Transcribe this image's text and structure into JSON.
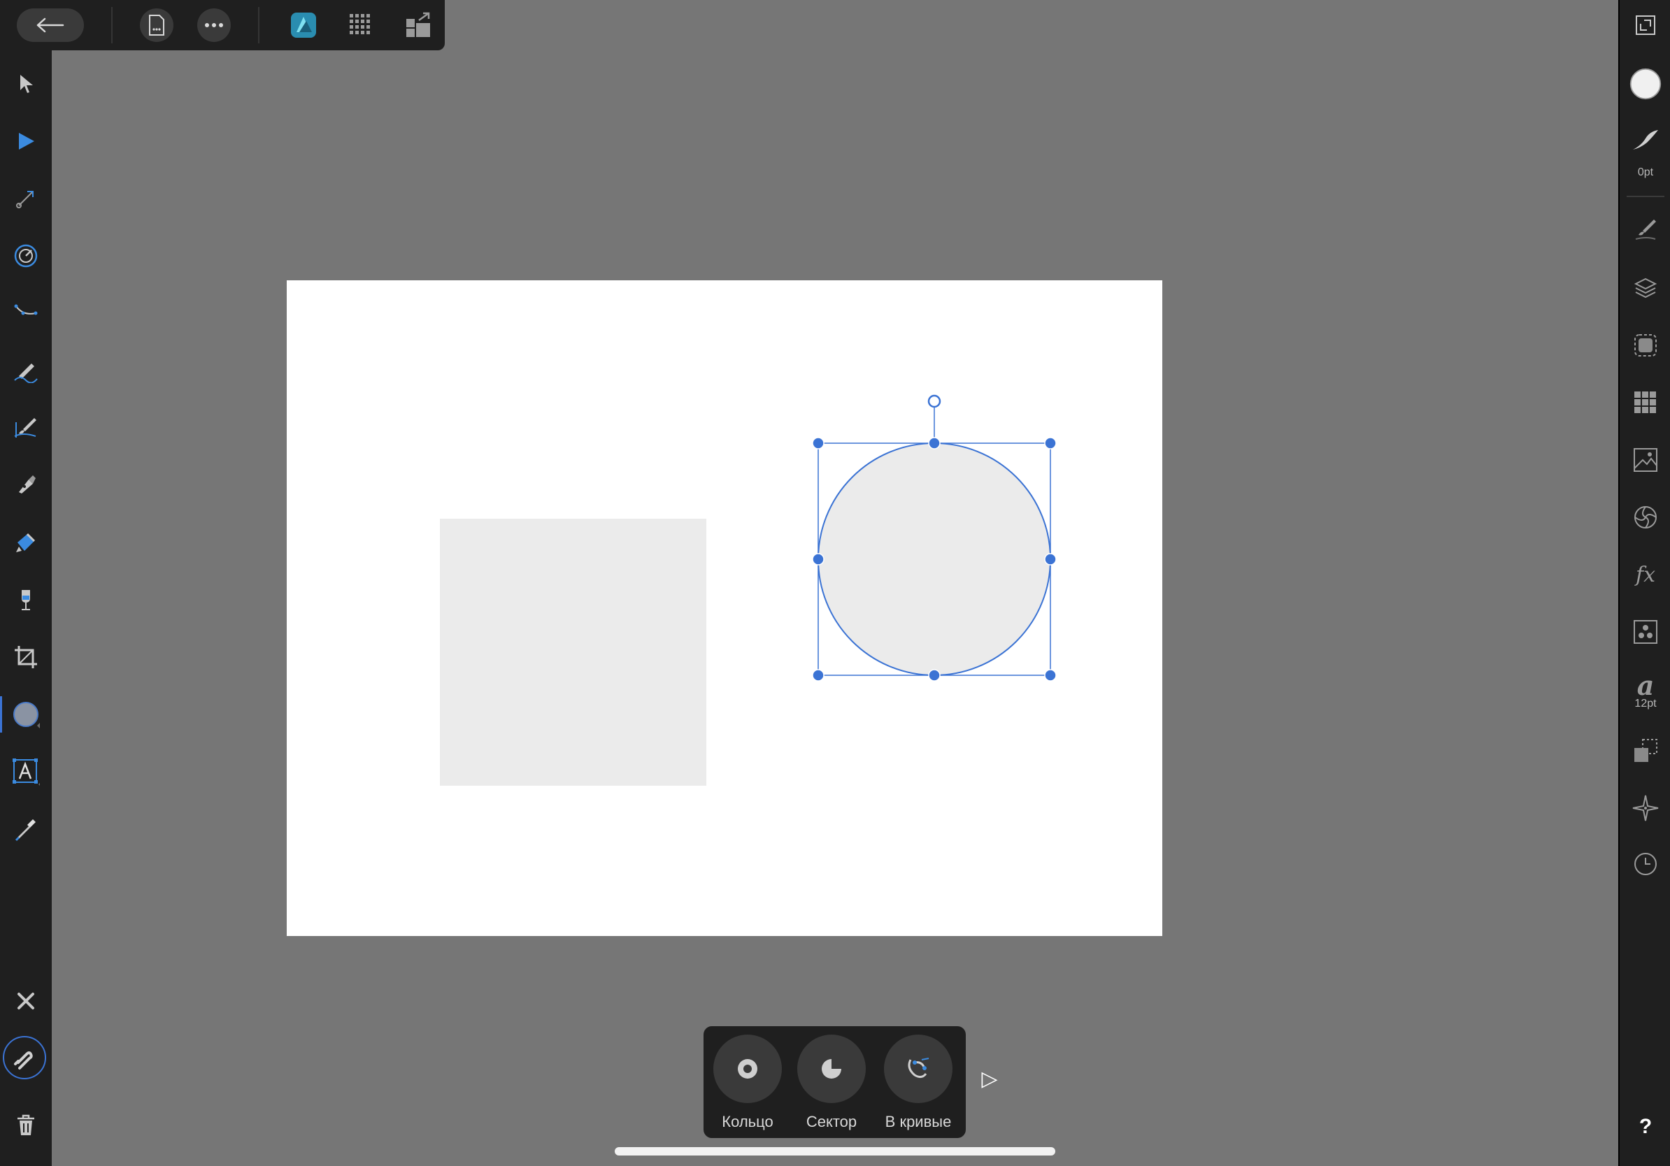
{
  "app": {
    "name": "Affinity Designer"
  },
  "top_toolbar": {
    "items": [
      "back-arrow-icon",
      "document-menu-icon",
      "more-icon",
      "designer-persona-icon",
      "pixel-persona-icon",
      "export-persona-icon"
    ]
  },
  "left_toolbar": {
    "tools": [
      "move-tool",
      "node-tool",
      "point-transform-tool",
      "corner-tool",
      "pen-tool",
      "pencil-tool",
      "vector-brush-tool",
      "fill-tool",
      "transparency-tool",
      "vector-crop-tool",
      "ellipse-tool",
      "artistic-text-tool",
      "color-picker-tool"
    ],
    "selected_tool": "ellipse-tool",
    "bottom": [
      "close-icon",
      "snapping-icon",
      "trash-icon"
    ]
  },
  "right_toolbar": {
    "stroke_width_label": "0pt",
    "text_size_label": "12pt",
    "text_style_glyph": "a",
    "fx_glyph": "fx",
    "help_label": "?",
    "fill_color": "#f0f0f0"
  },
  "canvas": {
    "artboard_color": "#ffffff",
    "shape_fill": "#ebebeb",
    "selection_color": "#3b73d4"
  },
  "context_bar": {
    "buttons": [
      {
        "label": "Кольцо",
        "icon": "donut-icon"
      },
      {
        "label": "Сектор",
        "icon": "pie-icon"
      },
      {
        "label": "В кривые",
        "icon": "convert-to-curves-icon"
      }
    ],
    "expand_glyph": "▷"
  }
}
